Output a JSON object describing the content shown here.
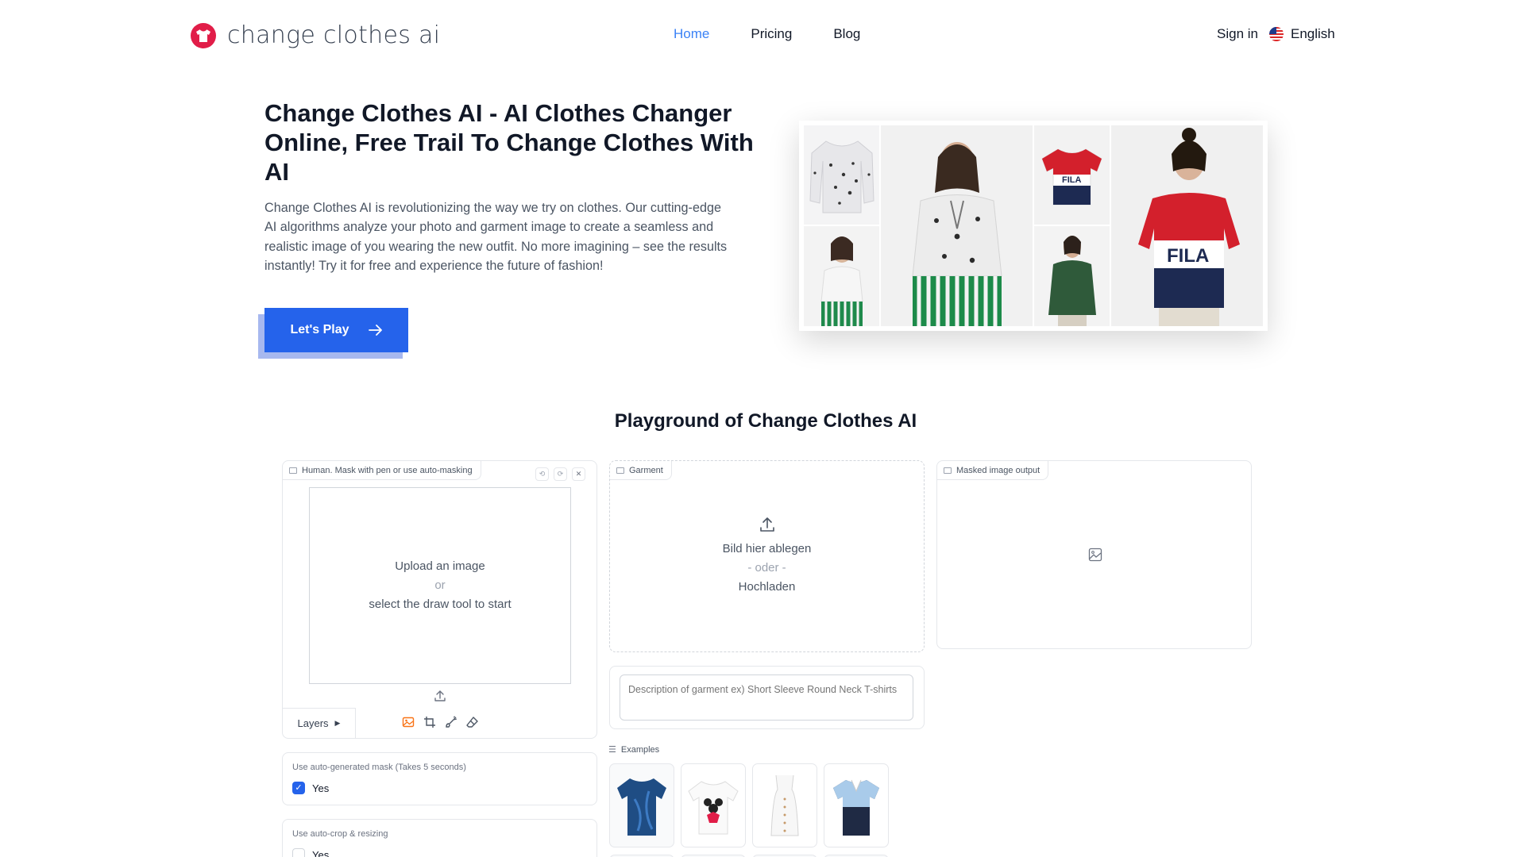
{
  "header": {
    "logo_text": "change clothes ai",
    "nav": [
      {
        "label": "Home",
        "active": true
      },
      {
        "label": "Pricing",
        "active": false
      },
      {
        "label": "Blog",
        "active": false
      }
    ],
    "sign_in": "Sign in",
    "language": "English"
  },
  "hero": {
    "title": "Change Clothes AI - AI Clothes Changer Online, Free Trail To Change Clothes With AI",
    "description": "Change Clothes AI is revolutionizing the way we try on clothes. Our cutting-edge AI algorithms analyze your photo and garment image to create a seamless and realistic image of you wearing the new outfit. No more imagining – see the results instantly! Try it for free and experience the future of fashion!",
    "cta_label": "Let's Play"
  },
  "playground": {
    "title": "Playground of Change Clothes AI",
    "human_panel": {
      "label": "Human. Mask with pen or use auto-masking",
      "upload_line1": "Upload an image",
      "upload_or": "or",
      "upload_line2": "select the draw tool to start",
      "layers_label": "Layers"
    },
    "garment_panel": {
      "label": "Garment",
      "drop_text": "Bild hier ablegen",
      "or_text": "- oder -",
      "upload_text": "Hochladen"
    },
    "output_panel": {
      "label": "Masked image output"
    },
    "description_placeholder": "Description of garment ex) Short Sleeve Round Neck T-shirts",
    "examples_label": "Examples",
    "auto_mask": {
      "label": "Use auto-generated mask (Takes 5 seconds)",
      "option": "Yes",
      "checked": true
    },
    "auto_crop": {
      "label": "Use auto-crop & resizing",
      "option": "Yes",
      "checked": false
    }
  },
  "colors": {
    "accent": "#2563eb",
    "nav_active": "#3b82f6",
    "logo": "#e11d48"
  }
}
